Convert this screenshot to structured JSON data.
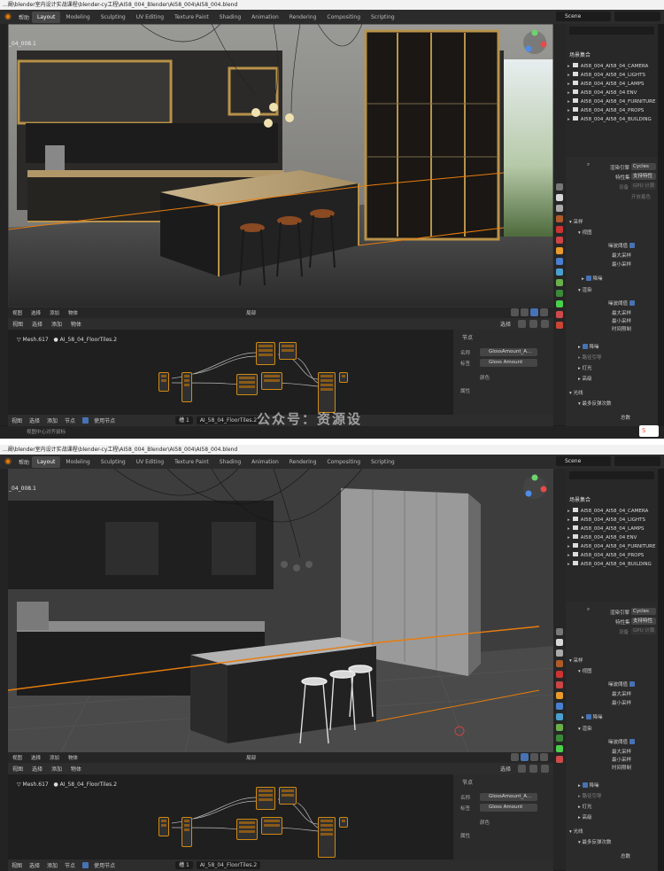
{
  "screenshot_top": {
    "window_title": "...阚\\blender室内设计实战课程\\blender-cy工程\\AI58_004_Blender\\AI58_004\\AI58_004.blend",
    "menus": [
      "帮助"
    ],
    "workspaces": [
      "Layout",
      "Modeling",
      "Sculpting",
      "UV Editing",
      "Texture Paint",
      "Shading",
      "Animation",
      "Rendering",
      "Compositing",
      "Scripting"
    ],
    "active_workspace": "Layout",
    "scene_name": "Scene",
    "viewport_object_label": "_04_008.1",
    "viewport_mode": "渲染预览",
    "viewport_tools": [
      "选择",
      "视图",
      "添加",
      "物体"
    ],
    "node_header": {
      "menus": [
        "视图",
        "选择",
        "添加",
        "物体"
      ],
      "mode": "局部",
      "select_label": "选择"
    },
    "node_breadcrumb": {
      "mesh": "Mesh.617",
      "material": "AI_58_04_FloorTiles.2"
    },
    "node_sidebar": {
      "tab": "节点",
      "name_label": "名称",
      "name_value": "GlossAmount_A...",
      "label_label": "标签",
      "label_value": "Gloss Amount",
      "color_label": "颜色",
      "properties_label": "属性"
    },
    "node_bottom": {
      "menus": [
        "视图",
        "选择",
        "添加",
        "节点"
      ],
      "use_nodes_label": "使用节点",
      "slot": "槽 1",
      "material": "AI_58_04_FloorTiles.2"
    },
    "status_text": "视图中心对齐鼠标",
    "outliner": {
      "root": "场景集合",
      "items": [
        "AI58_004_AI58_04_CAMERA",
        "AI58_004_AI58_04_LIGHTS",
        "AI58_004_AI58_04_LAMPS",
        "AI58_004_AI58_04 ENV",
        "AI58_004_AI58_04_FURNITURE",
        "AI58_004_AI58_04_PROPS",
        "AI58_004_AI58_04_BUILDING"
      ]
    },
    "properties": {
      "render_engine_label": "渲染引擎",
      "render_engine": "Cycles",
      "feature_set_label": "特性集",
      "feature_set": "支持特性",
      "device_label": "设备",
      "device": "GPU 计算",
      "open_shading_language": "开放着色",
      "sampling": "采样",
      "viewport": "视图",
      "noise_threshold": "噪波阈值",
      "max_samples": "最大采样",
      "min_samples": "最小采样",
      "denoise": "降噪",
      "render": "渲染",
      "time_limit": "时间限制",
      "path_guiding": "路径引导",
      "lights": "灯光",
      "advanced": "高级",
      "light_paths": "光线",
      "max_bounces": "最多反弹次数",
      "total": "总数"
    }
  },
  "screenshot_bottom": {
    "window_title": "...阚\\blender室内设计实战课程\\blender-cy工程\\AI58_004_Blender\\AI58_004\\AI58_004.blend",
    "workspaces": [
      "Layout",
      "Modeling",
      "Sculpting",
      "UV Editing",
      "Texture Paint",
      "Shading",
      "Animation",
      "Rendering",
      "Compositing",
      "Scripting"
    ],
    "active_workspace": "Layout",
    "scene_name": "Scene",
    "viewport_object_label": "_04_008.1",
    "viewport_mode": "实体"
  },
  "watermark": "公众号：资源设",
  "colors": {
    "accent_orange": "#e87d0d",
    "selection_blue": "#4772b3",
    "panel_dark": "#1d1d1d"
  }
}
